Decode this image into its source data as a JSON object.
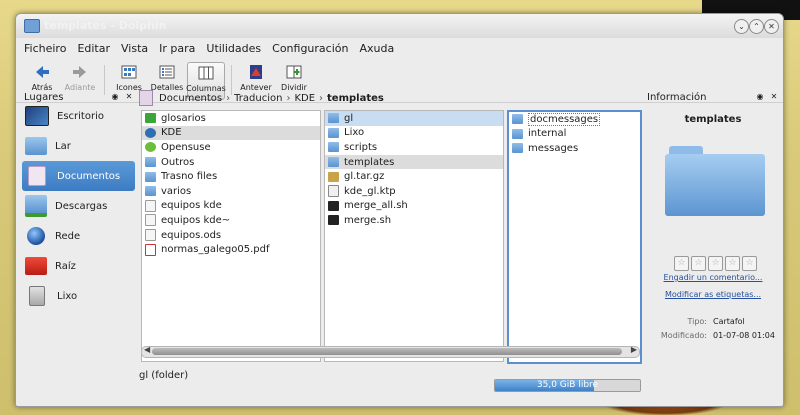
{
  "window": {
    "title": "templates - Dolphin"
  },
  "menu": [
    "Ficheiro",
    "Editar",
    "Vista",
    "Ir para",
    "Utilidades",
    "Configuración",
    "Axuda"
  ],
  "toolbar": {
    "back": "Atrás",
    "forward": "Adiante",
    "icons": "Icones",
    "details": "Detalles",
    "columns": "Columnas",
    "preview": "Antever",
    "split": "Dividir"
  },
  "places": {
    "title": "Lugares",
    "items": [
      {
        "label": "Escritorio",
        "icon": "desktop-icon"
      },
      {
        "label": "Lar",
        "icon": "home-icon"
      },
      {
        "label": "Documentos",
        "icon": "documents-icon"
      },
      {
        "label": "Descargas",
        "icon": "downloads-icon"
      },
      {
        "label": "Rede",
        "icon": "network-icon"
      },
      {
        "label": "Raíz",
        "icon": "root-folder-icon"
      },
      {
        "label": "Lixo",
        "icon": "trash-icon"
      }
    ],
    "selected": "Documentos"
  },
  "breadcrumb": [
    "Documentos",
    "Traducion",
    "KDE",
    "templates"
  ],
  "columns": [
    {
      "items": [
        {
          "name": "glosarios",
          "icon": "flag-icon"
        },
        {
          "name": "KDE",
          "icon": "kde-icon"
        },
        {
          "name": "Opensuse",
          "icon": "opensuse-icon"
        },
        {
          "name": "Outros",
          "icon": "folder-icon"
        },
        {
          "name": "Trasno files",
          "icon": "folder-icon"
        },
        {
          "name": "varios",
          "icon": "folder-icon"
        },
        {
          "name": "equipos kde",
          "icon": "document-icon"
        },
        {
          "name": "equipos kde~",
          "icon": "document-icon"
        },
        {
          "name": "equipos.ods",
          "icon": "spreadsheet-icon"
        },
        {
          "name": "normas_galego05.pdf",
          "icon": "pdf-icon"
        }
      ],
      "selected": "KDE"
    },
    {
      "items": [
        {
          "name": "gl",
          "icon": "folder-icon"
        },
        {
          "name": "Lixo",
          "icon": "folder-icon"
        },
        {
          "name": "scripts",
          "icon": "folder-icon"
        },
        {
          "name": "templates",
          "icon": "folder-icon"
        },
        {
          "name": "gl.tar.gz",
          "icon": "archive-icon"
        },
        {
          "name": "kde_gl.ktp",
          "icon": "document-icon"
        },
        {
          "name": "merge_all.sh",
          "icon": "terminal-script-icon"
        },
        {
          "name": "merge.sh",
          "icon": "terminal-script-icon"
        }
      ],
      "selected": "templates",
      "highlighted": "gl"
    },
    {
      "items": [
        {
          "name": "docmessages",
          "icon": "folder-icon"
        },
        {
          "name": "internal",
          "icon": "folder-icon"
        },
        {
          "name": "messages",
          "icon": "folder-icon"
        }
      ]
    }
  ],
  "status": {
    "text": "gl (folder)",
    "free_space": "35,0 GiB libre",
    "used_fraction": 0.68
  },
  "info": {
    "title": "Información",
    "name": "templates",
    "rating_stars": 5,
    "comment_link": "Engadir un comentario...",
    "tags_link": "Modificar as etiquetas...",
    "type_key": "Tipo:",
    "type_value": "Cartafol",
    "modified_key": "Modificado:",
    "modified_value": "01-07-08 01:04"
  }
}
